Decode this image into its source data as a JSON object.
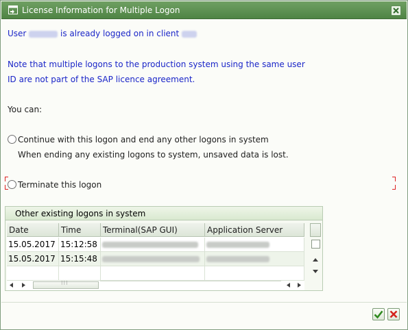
{
  "window": {
    "title": "License Information for Multiple Logon"
  },
  "message": {
    "user_prefix": "User",
    "user_suffix": "is already logged on in client",
    "note_line1": "Note that multiple logons to the production system using the same user",
    "note_line2": "ID are not part of the SAP licence agreement.",
    "you_can": "You can:"
  },
  "options": [
    {
      "label": "Continue with this logon and end any other logons in system",
      "hint": "When ending any existing logons to system, unsaved data is lost.",
      "selected": false
    },
    {
      "label": "Terminate this logon",
      "selected": false
    }
  ],
  "logons_group": {
    "title": "Other existing logons in system",
    "columns": [
      "Date",
      "Time",
      "Terminal(SAP GUI)",
      "Application Server"
    ],
    "rows": [
      {
        "date": "15.05.2017",
        "time": "15:12:58"
      },
      {
        "date": "15.05.2017",
        "time": "15:15:48"
      }
    ]
  },
  "colors": {
    "titlebar": "#4f8444",
    "message_text": "#1a25c8",
    "focus_corners": "#dd2222"
  },
  "icons": {
    "title": "window-icon",
    "close": "close-icon",
    "confirm": "checkmark-icon",
    "cancel": "cancel-icon"
  }
}
